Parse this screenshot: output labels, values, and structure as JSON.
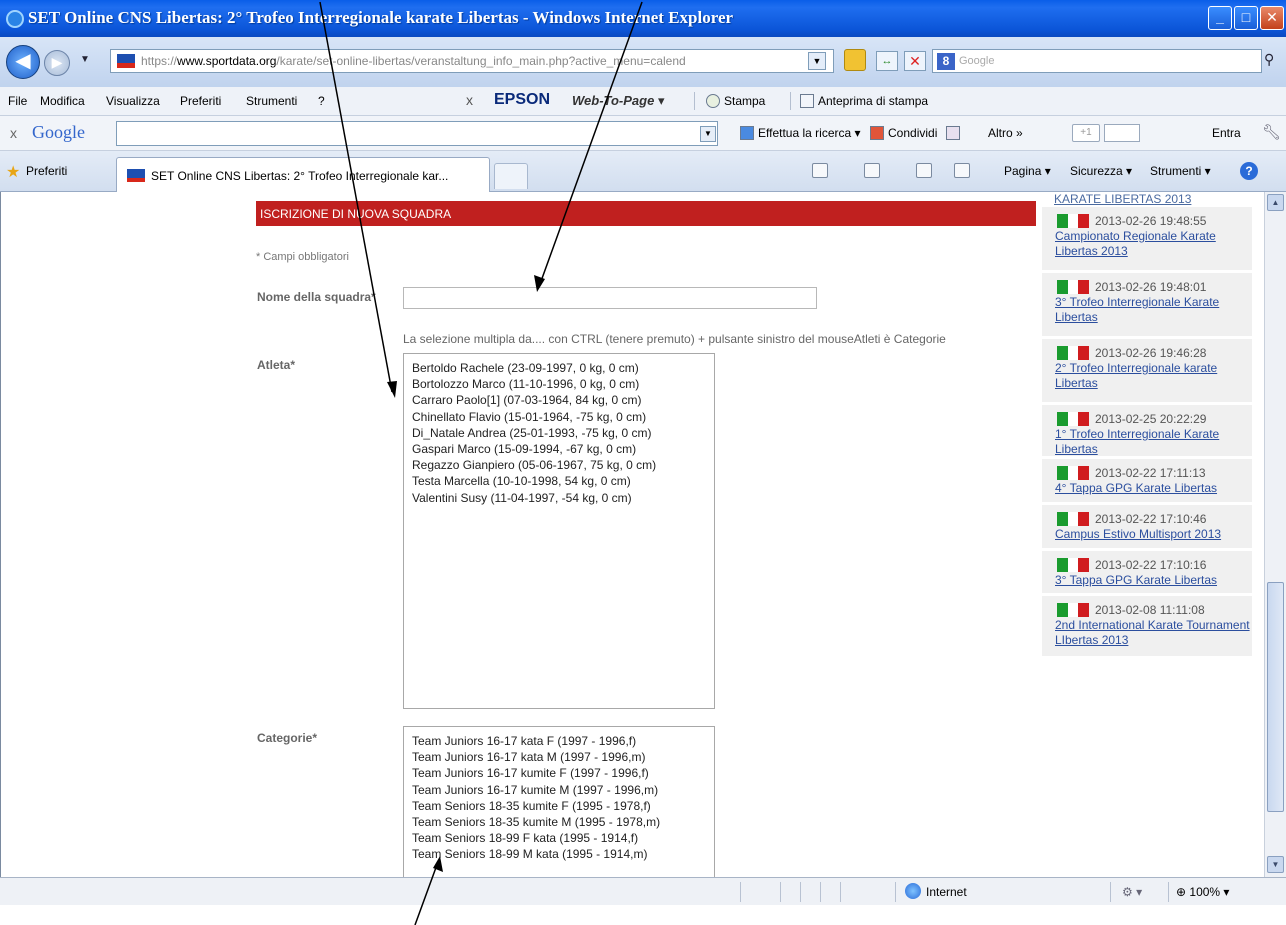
{
  "window": {
    "title": "SET Online CNS Libertas: 2° Trofeo Interregionale karate Libertas - Windows Internet Explorer",
    "minimize": "_",
    "maximize": "□",
    "close": "✕"
  },
  "address": {
    "url_prefix": "https://",
    "url_domain": "www.sportdata.org",
    "url_path": "/karate/set-online-libertas/veranstaltung_info_main.php?active_menu=calend",
    "search_placeholder": "Google",
    "search_engine_icon": "g-icon"
  },
  "menu": {
    "items": [
      "File",
      "Modifica",
      "Visualizza",
      "Preferiti",
      "Strumenti",
      "?"
    ],
    "epson_close": "x",
    "epson": "EPSON",
    "web_to_page": "Web-To-Page ▾",
    "print": "Stampa",
    "preview": "Anteprima di stampa"
  },
  "google_toolbar": {
    "close": "x",
    "logo": "Google",
    "search_label": "Effettua la ricerca ▾",
    "share_label": "Condividi",
    "more_label": "Altro »",
    "plus_label": "+1",
    "signin_label": "Entra"
  },
  "tabs": {
    "favorites_label": "Preferiti",
    "active_tab_label": "SET Online CNS Libertas: 2° Trofeo Interregionale kar...",
    "page_menu": "Pagina ▾",
    "security_menu": "Sicurezza ▾",
    "tools_menu": "Strumenti ▾",
    "help": "?"
  },
  "form": {
    "header": "ISCRIZIONE DI NUOVA SQUADRA",
    "required_note": "* Campi obbligatori",
    "team_name_label": "Nome della squadra*",
    "team_name_value": "",
    "hint": "La selezione multipla da.... con CTRL (tenere premuto) + pulsante sinistro del mouseAtleti è Categorie",
    "athlete_label": "Atleta*",
    "athletes": [
      "Bertoldo Rachele (23-09-1997, 0 kg, 0 cm)",
      "Bortolozzo Marco (11-10-1996, 0 kg, 0 cm)",
      "Carraro Paolo[1] (07-03-1964, 84 kg, 0 cm)",
      "Chinellato Flavio (15-01-1964, -75 kg, 0 cm)",
      "Di_Natale Andrea (25-01-1993, -75 kg, 0 cm)",
      "Gaspari Marco (15-09-1994, -67 kg, 0 cm)",
      "Regazzo Gianpiero (05-06-1967, 75 kg, 0 cm)",
      "Testa Marcella (10-10-1998, 54 kg, 0 cm)",
      "Valentini Susy (11-04-1997, -54 kg, 0 cm)"
    ],
    "category_label": "Categorie*",
    "categories": [
      "Team Juniors 16-17 kata F (1997 - 1996,f)",
      "Team Juniors 16-17 kata M (1997 - 1996,m)",
      "Team Juniors 16-17 kumite F (1997 - 1996,f)",
      "Team Juniors 16-17 kumite M (1997 - 1996,m)",
      "Team Seniors 18-35 kumite F (1995 - 1978,f)",
      "Team Seniors 18-35 kumite M (1995 - 1978,m)",
      "Team Seniors 18-99 F kata (1995 - 1914,f)",
      "Team Seniors 18-99 M kata (1995 - 1914,m)"
    ]
  },
  "sidebar": {
    "top_link": "KARATE LIBERTAS 2013",
    "flag_colors": [
      "#1a9b2e",
      "#ffffff",
      "#d01c1f"
    ],
    "news": [
      {
        "date": "2013-02-26 19:48:55",
        "title": "Campionato Regionale Karate Libertas 2013"
      },
      {
        "date": "2013-02-26 19:48:01",
        "title": "3° Trofeo Interregionale Karate Libertas"
      },
      {
        "date": "2013-02-26 19:46:28",
        "title": "2° Trofeo Interregionale karate Libertas"
      },
      {
        "date": "2013-02-25 20:22:29",
        "title": "1° Trofeo Interregionale Karate Libertas"
      },
      {
        "date": "2013-02-22 17:11:13",
        "title": "4° Tappa GPG Karate Libertas"
      },
      {
        "date": "2013-02-22 17:10:46",
        "title": "Campus Estivo Multisport 2013"
      },
      {
        "date": "2013-02-22 17:10:16",
        "title": "3° Tappa GPG Karate Libertas"
      },
      {
        "date": "2013-02-08 11:11:08",
        "title": "2nd International Karate Tournament LIbertas 2013"
      }
    ]
  },
  "status": {
    "zone": "Internet",
    "zoom": "100%"
  },
  "colors": {
    "header_red": "#c0201f",
    "link_blue": "#2b4e9e"
  }
}
